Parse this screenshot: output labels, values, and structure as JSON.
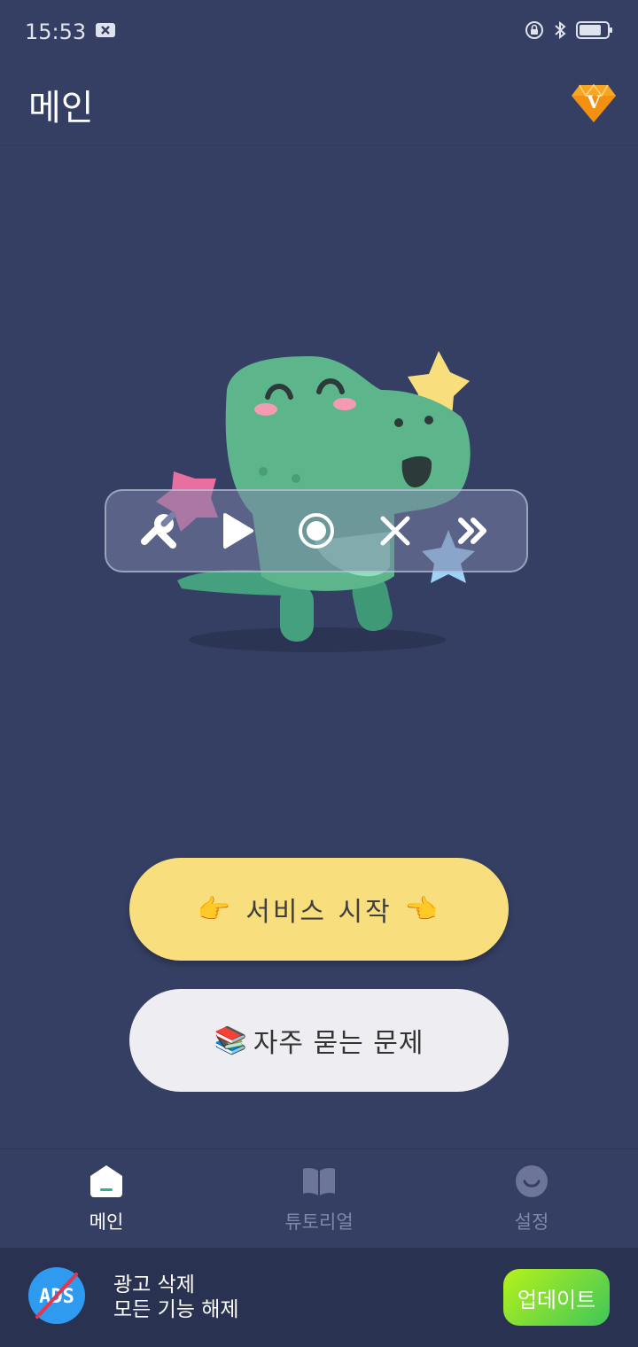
{
  "status_bar": {
    "time": "15:53"
  },
  "header": {
    "title": "메인"
  },
  "main": {
    "start_label": "서비스 시작",
    "faq_label": "자주 묻는 문제",
    "start_emoji_left": "👉",
    "start_emoji_right": "👈",
    "faq_emoji": "📚"
  },
  "toolbar": {
    "icons": [
      "wrench-icon",
      "play-icon",
      "record-icon",
      "close-icon",
      "fast-forward-icon"
    ]
  },
  "bottom_nav": {
    "items": [
      {
        "label": "메인",
        "icon": "home-icon",
        "active": true
      },
      {
        "label": "튜토리얼",
        "icon": "book-icon",
        "active": false
      },
      {
        "label": "설정",
        "icon": "smile-icon",
        "active": false
      }
    ]
  },
  "ad_banner": {
    "line1": "광고 삭제",
    "line2": "모든 기능 해제",
    "update_label": "업데이트",
    "ads_text": "ADS"
  },
  "colors": {
    "background": "#353F63",
    "start_button": "#F8DE7C",
    "faq_button": "#EEEEF2",
    "update_gradient_start": "#b6f21a",
    "update_gradient_end": "#3ec65a"
  }
}
